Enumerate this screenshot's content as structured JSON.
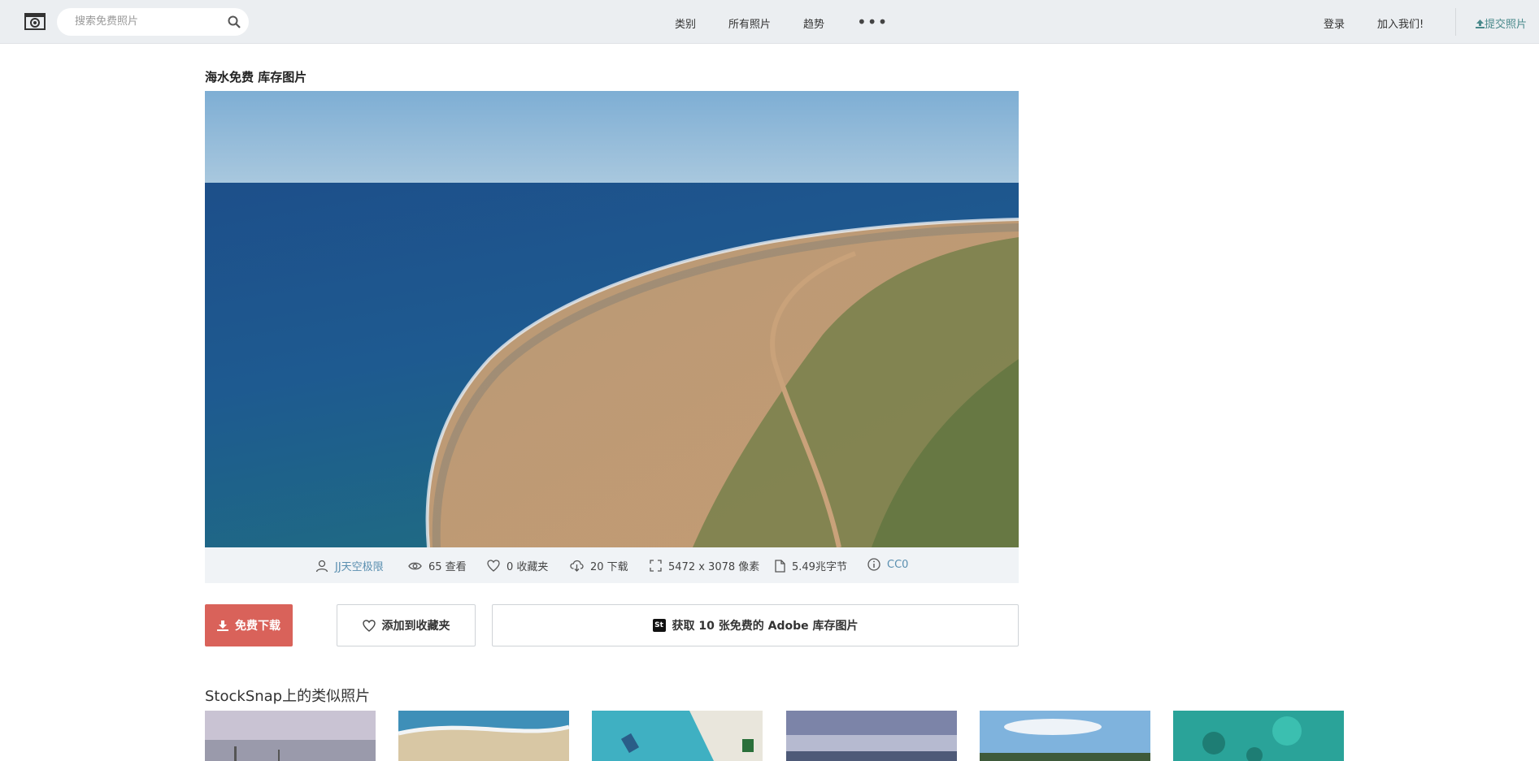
{
  "header": {
    "search_placeholder": "搜索免费照片",
    "nav": [
      "类别",
      "所有照片",
      "趋势"
    ],
    "more_label": "•••",
    "login": "登录",
    "join": "加入我们!",
    "submit": "提交照片"
  },
  "photo": {
    "title": "海水免费 库存图片",
    "author": "JJ天空极限",
    "views": "65 查看",
    "favorites": "0 收藏夹",
    "downloads": "20 下载",
    "dimensions": "5472 x 3078 像素",
    "filesize": "5.49兆字节",
    "license": "CC0"
  },
  "actions": {
    "download": "免费下载",
    "favorite": "添加到收藏夹",
    "adobe_badge": "St",
    "adobe": "获取 10 张免费的 Adobe 库存图片"
  },
  "similar": {
    "title": "StockSnap上的类似照片",
    "count": 6
  },
  "colors": {
    "accent_download": "#d9625a",
    "link": "#5a8fb0",
    "submit": "#4a8a8c",
    "topbar": "#ebeef1"
  }
}
